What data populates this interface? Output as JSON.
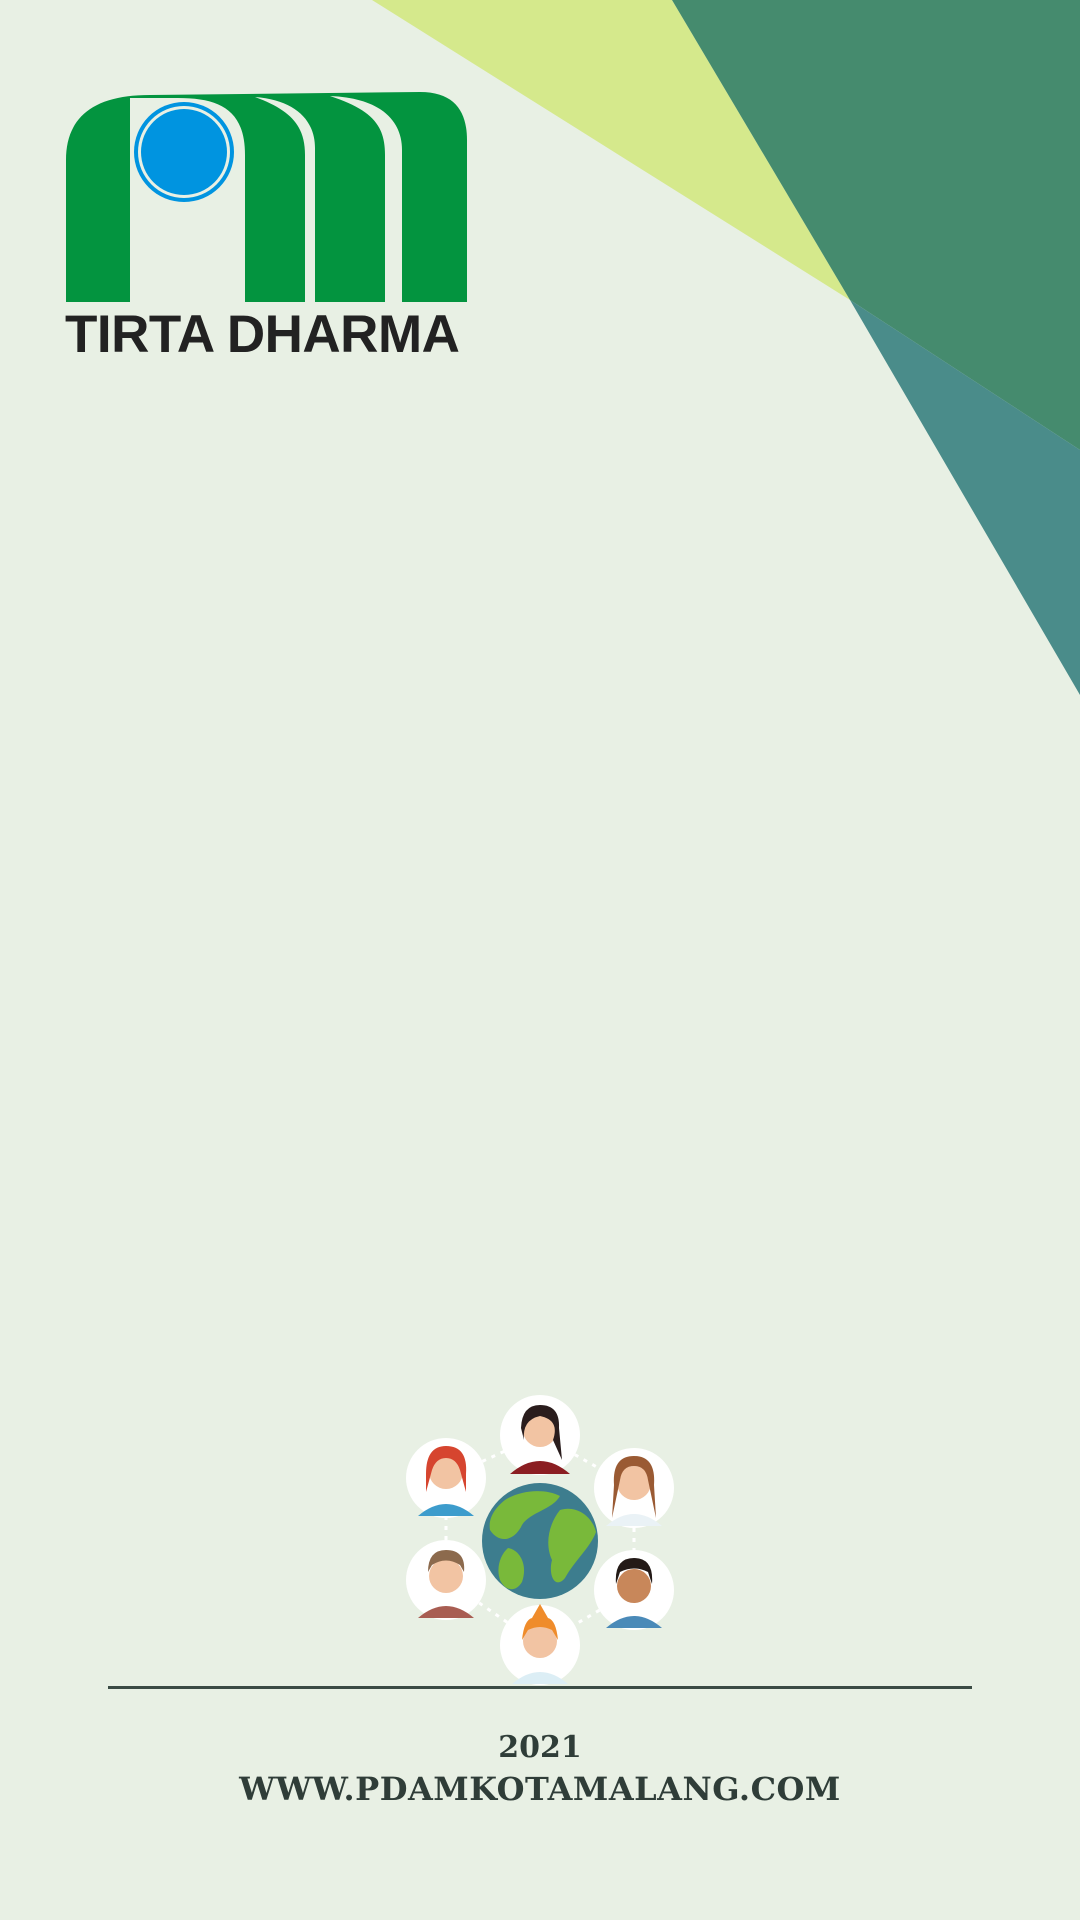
{
  "colors": {
    "background": "#e8f0e4",
    "lime": "#d5e98c",
    "dark_green": "#458b6e",
    "teal": "#4a8c8a",
    "logo_green": "#03943f",
    "logo_blue": "#0094e0"
  },
  "logo": {
    "text": "TIRTA DHARMA"
  },
  "illustration": {
    "icon": "people-around-globe-icon"
  },
  "footer": {
    "year": "2021",
    "website": "WWW.PDAMKOTAMALANG.COM"
  }
}
